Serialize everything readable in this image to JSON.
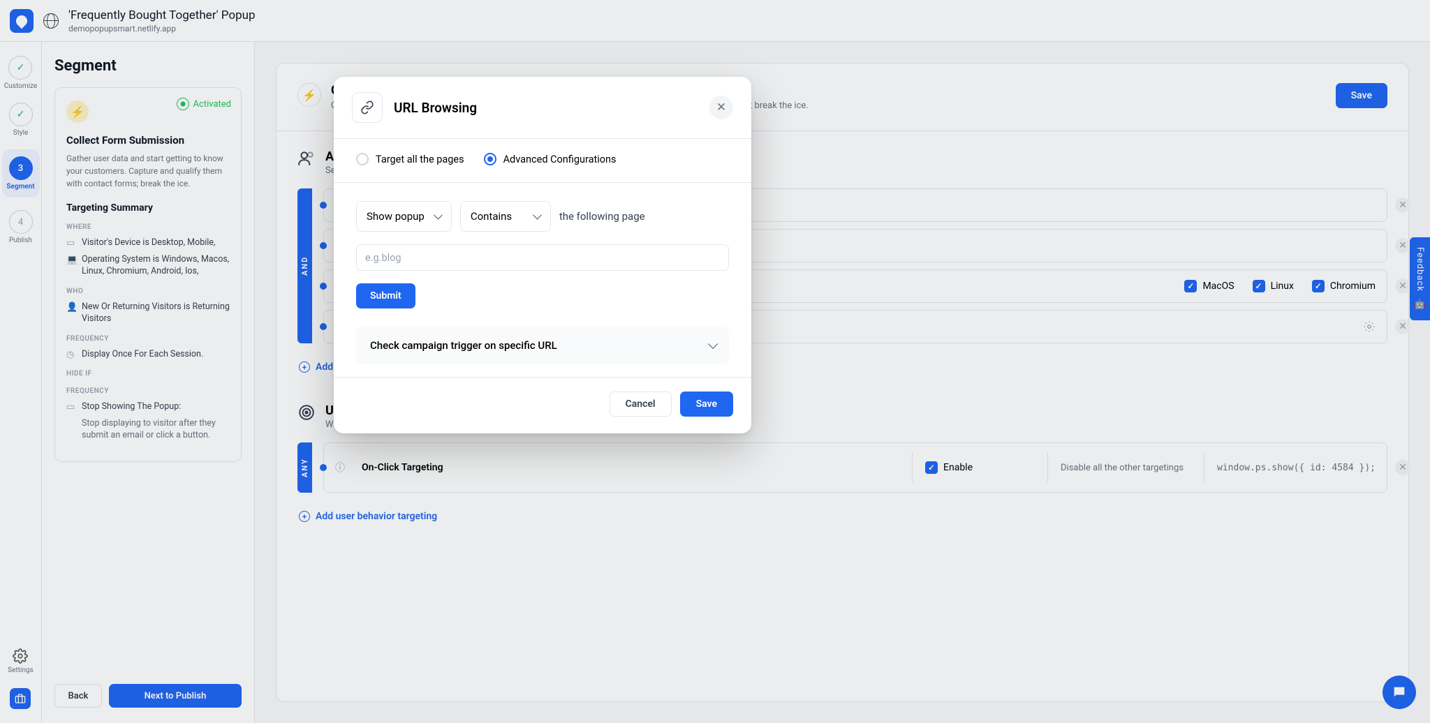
{
  "topbar": {
    "title": "'Frequently Bought Together' Popup",
    "subtitle": "demopopupsmart.netlify.app"
  },
  "rail": {
    "steps": [
      {
        "label": "Customize",
        "state": "done"
      },
      {
        "label": "Style",
        "state": "done"
      },
      {
        "num": "3",
        "label": "Segment",
        "state": "active"
      },
      {
        "num": "4",
        "label": "Publish",
        "state": "todo"
      }
    ],
    "settings_label": "Settings"
  },
  "panel": {
    "heading": "Segment",
    "activated": "Activated",
    "card_title": "Collect Form Submission",
    "card_desc": "Gather user data and start getting to know your customers. Capture and qualify them with contact forms; break the ice.",
    "summary_heading": "Targeting Summary",
    "groups": {
      "where": {
        "label": "WHERE",
        "lines": [
          "Visitor's Device is Desktop, Mobile,",
          "Operating System is Windows, Macos, Linux, Chromium, Android, Ios,"
        ]
      },
      "who": {
        "label": "WHO",
        "lines": [
          "New Or Returning Visitors is Returning Visitors"
        ]
      },
      "freq1": {
        "label": "FREQUENCY",
        "lines": [
          "Display Once For Each Session."
        ]
      },
      "hideif": {
        "label": "Hide if"
      },
      "freq2": {
        "label": "FREQUENCY",
        "lines": [
          "Stop Showing The Popup:",
          "Stop displaying to visitor after they submit an email or click a button."
        ]
      }
    },
    "back": "Back",
    "next": "Next to Publish"
  },
  "main": {
    "header": {
      "title": "Collect Form Submission",
      "desc": "Gather user data and start getting to know your customers. Capture and qualify them with contact forms; break the ice.",
      "save": "Save"
    },
    "audience": {
      "heading": "Audience",
      "sub": "Set who will see your campaign. You can combine the options.",
      "tag": "AND",
      "add": "Add audience targeting",
      "os": {
        "macos": "MacOS",
        "linux": "Linux",
        "chromium": "Chromium"
      }
    },
    "behavior": {
      "heading": "User Behavior",
      "sub": "When you want to display your campaign.",
      "tag": "ANY",
      "add": "Add user behavior targeting",
      "onclick": {
        "title": "On-Click Targeting",
        "enable": "Enable",
        "disable": "Disable all the other targetings",
        "code": "window.ps.show({ id: 4584 });"
      }
    }
  },
  "modal": {
    "title": "URL Browsing",
    "opt1": "Target all the pages",
    "opt2": "Advanced Configurations",
    "select_action": "Show popup",
    "select_match": "Contains",
    "static": "the following page",
    "placeholder": "e.g.blog",
    "submit": "Submit",
    "expander": "Check campaign trigger on specific URL",
    "cancel": "Cancel",
    "save": "Save"
  },
  "feedback": "Feedback"
}
